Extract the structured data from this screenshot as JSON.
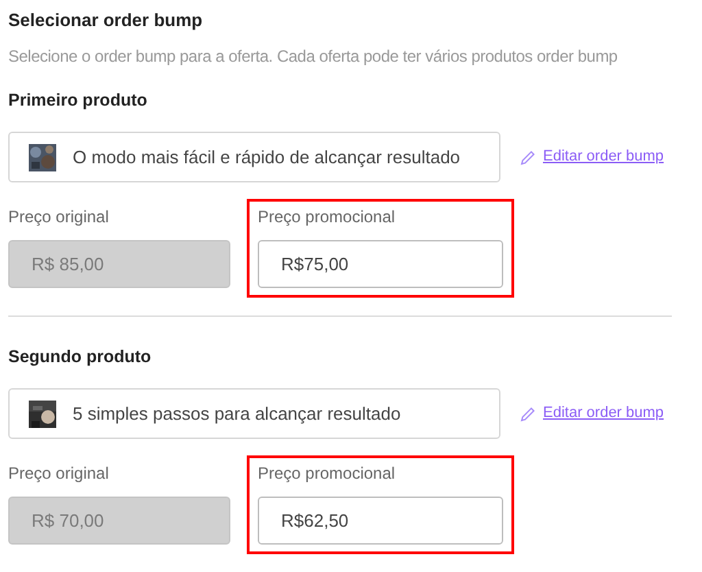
{
  "section": {
    "title": "Selecionar order bump",
    "description": "Selecione o order bump para a oferta. Cada oferta pode ter vários produtos order bump"
  },
  "products": [
    {
      "heading": "Primeiro produto",
      "name": "O modo mais fácil e rápido de alcançar resultado",
      "edit_link": "Editar order bump",
      "original_price": {
        "label": "Preço original",
        "value": "R$ 85,00",
        "disabled": true
      },
      "promo_price": {
        "label": "Preço promocional",
        "value": "R$75,00",
        "highlighted": true
      }
    },
    {
      "heading": "Segundo produto",
      "name": "5 simples passos para alcançar resultado",
      "edit_link": "Editar order bump",
      "original_price": {
        "label": "Preço original",
        "value": "R$ 70,00",
        "disabled": true
      },
      "promo_price": {
        "label": "Preço promocional",
        "value": "R$62,50",
        "highlighted": true
      }
    }
  ]
}
